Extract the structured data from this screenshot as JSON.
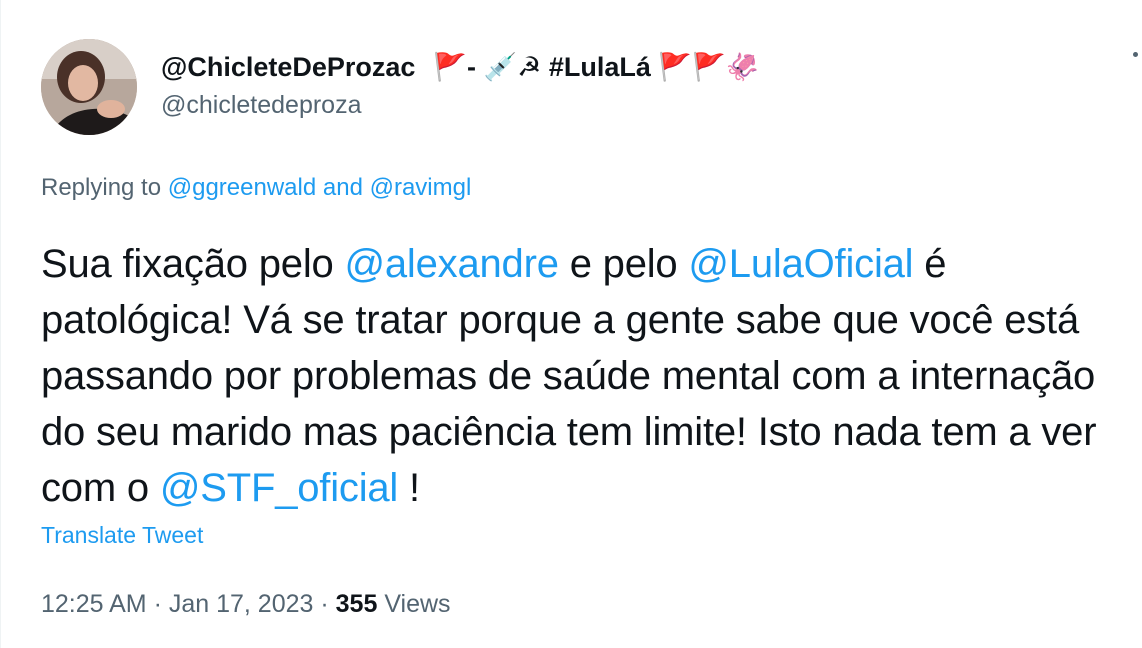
{
  "author": {
    "display_name": "@ChicleteDeProzac",
    "display_name_suffix": "🚩- 💉☭ #LulaLá 🚩🚩🦑",
    "handle": "@chicletedeproza"
  },
  "replying": {
    "prefix": "Replying to",
    "user1": "@ggreenwald",
    "and": "and",
    "user2": "@ravimgl"
  },
  "tweet": {
    "part1": "Sua fixação pelo ",
    "mention1": "@alexandre",
    "part2": " e pelo ",
    "mention2": "@LulaOficial",
    "part3": " é patológica! Vá se tratar porque a gente sabe que você está passando por problemas de saúde mental com a internação do seu marido mas paciência tem limite! Isto nada tem a ver com o ",
    "mention3": "@STF_oficial",
    "part4": " !"
  },
  "translate_label": "Translate Tweet",
  "meta": {
    "time": "12:25 AM",
    "sep1": " · ",
    "date": "Jan 17, 2023",
    "sep2": " · ",
    "views_count": "355",
    "views_label": " Views"
  }
}
